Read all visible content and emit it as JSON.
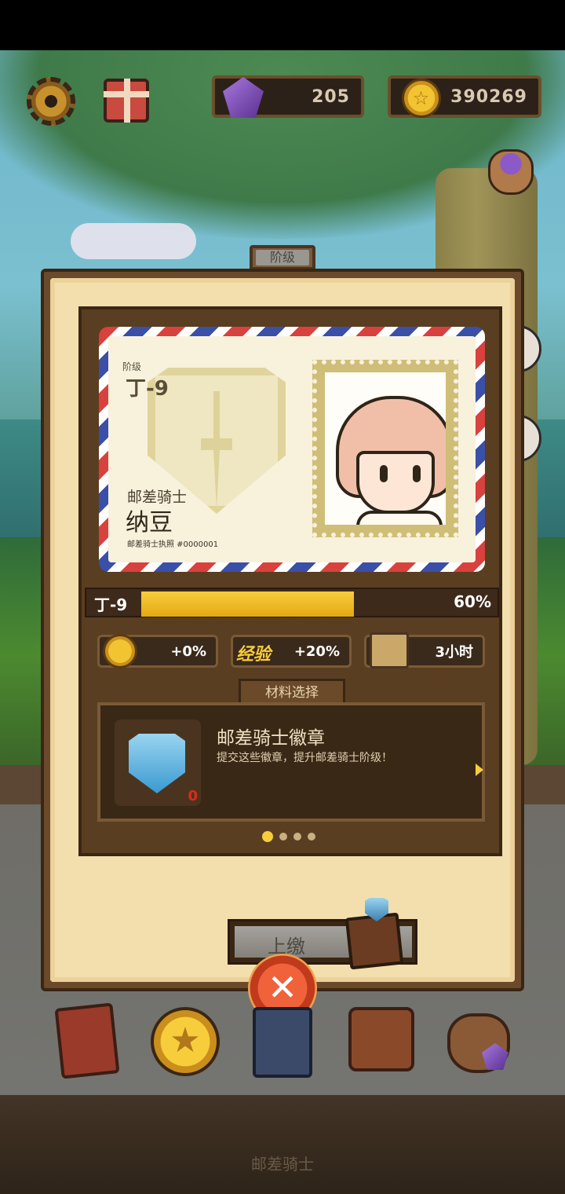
{
  "hud": {
    "gems": "205",
    "coins": "390269"
  },
  "panel": {
    "tab_label": "阶级",
    "card": {
      "rank_label": "阶级",
      "rank": "丁-9",
      "role": "邮差骑士",
      "name": "纳豆",
      "license": "邮差骑士执照 #0000001"
    },
    "progress": {
      "label": "丁-9",
      "percent_text": "60%",
      "fraction": 0.6
    },
    "bonuses": [
      {
        "icon": "coin-icon",
        "value": "+0%"
      },
      {
        "icon": "exp-icon",
        "label": "经验",
        "value": "+20%"
      },
      {
        "icon": "crate-icon",
        "value": "3小时"
      }
    ],
    "materials": {
      "tab_label": "材料选择",
      "item_title": "邮差骑士徽章",
      "item_desc": "提交这些徽章，提升邮差骑士阶级！",
      "item_count": "0",
      "page_count": 4,
      "active_page": 0
    },
    "submit_label": "上缴"
  },
  "close_symbol": "✕",
  "footer_title": "邮差骑士",
  "colors": {
    "accent_gold": "#f7cd3c",
    "panel_brown": "#6a4a2a",
    "paper": "#f3dfae",
    "count_red": "#e02a1a"
  }
}
